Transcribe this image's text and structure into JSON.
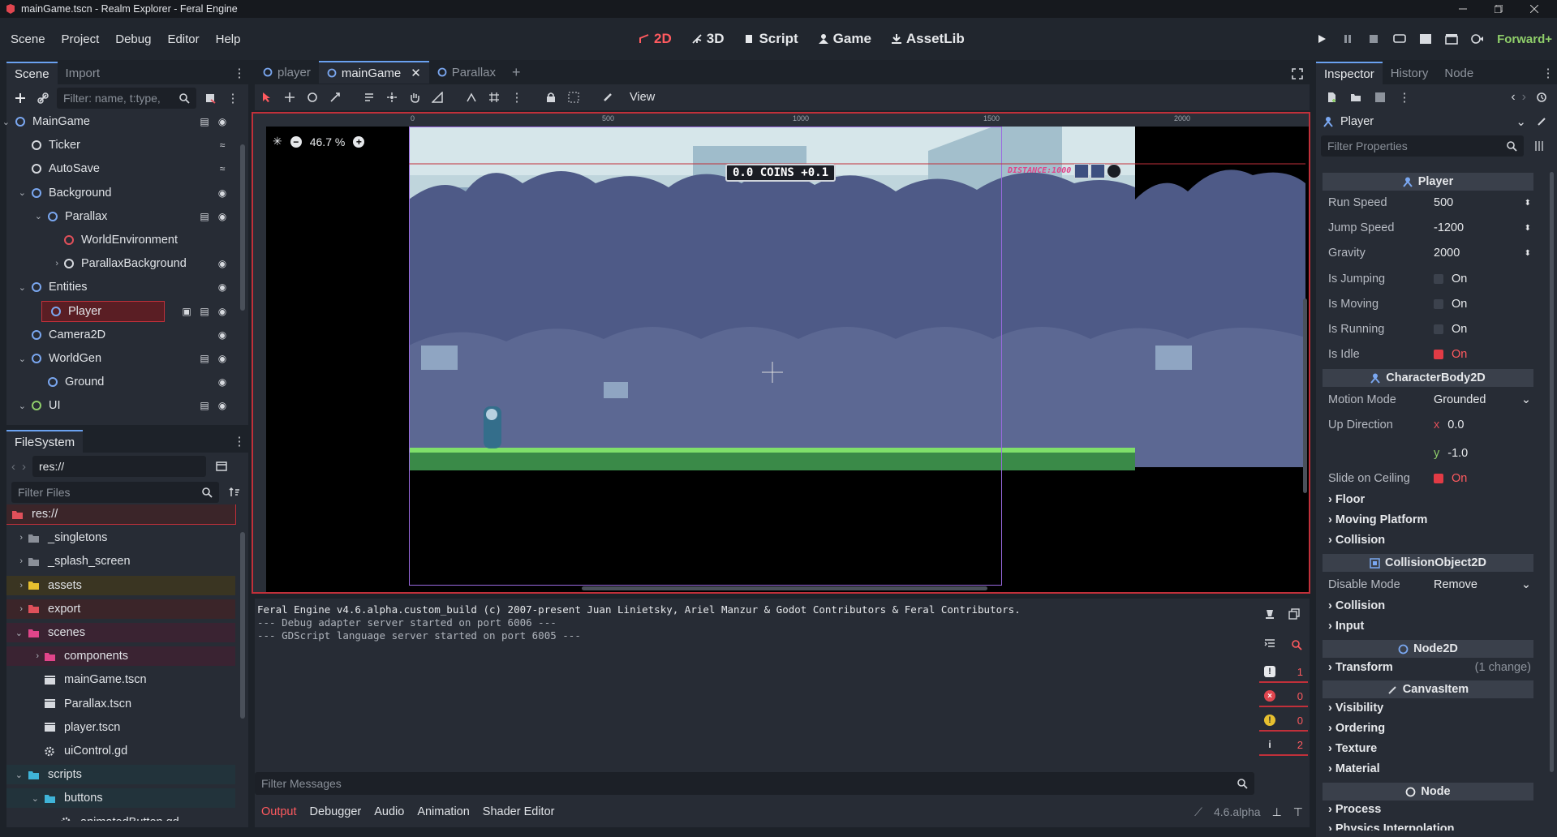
{
  "window": {
    "title": "mainGame.tscn - Realm Explorer - Feral Engine"
  },
  "menu": [
    "Scene",
    "Project",
    "Debug",
    "Editor",
    "Help"
  ],
  "workspaces": [
    {
      "label": "2D",
      "icon": "2d-icon",
      "active": true
    },
    {
      "label": "3D",
      "icon": "3d-icon",
      "active": false
    },
    {
      "label": "Script",
      "icon": "script-icon",
      "active": false
    },
    {
      "label": "Game",
      "icon": "game-icon",
      "active": false
    },
    {
      "label": "AssetLib",
      "icon": "assetlib-icon",
      "active": false
    }
  ],
  "renderer": "Forward+",
  "scene_dock": {
    "tabs": [
      "Scene",
      "Import"
    ],
    "filter_placeholder": "Filter: name, t:type,",
    "tree": [
      {
        "label": "MainGame",
        "depth": 0,
        "icon": "node2d-icon",
        "arrow": "down"
      },
      {
        "label": "Ticker",
        "depth": 1,
        "icon": "timer-icon"
      },
      {
        "label": "AutoSave",
        "depth": 1,
        "icon": "timer-icon"
      },
      {
        "label": "Background",
        "depth": 1,
        "icon": "node2d-icon",
        "arrow": "down"
      },
      {
        "label": "Parallax",
        "depth": 2,
        "icon": "node2d-icon",
        "arrow": "down"
      },
      {
        "label": "WorldEnvironment",
        "depth": 3,
        "icon": "world-environment-icon"
      },
      {
        "label": "ParallaxBackground",
        "depth": 3,
        "icon": "parallax-icon",
        "arrow": "right"
      },
      {
        "label": "Entities",
        "depth": 1,
        "icon": "node2d-icon",
        "arrow": "down"
      },
      {
        "label": "Player",
        "depth": 2,
        "icon": "character-icon",
        "selected": true
      },
      {
        "label": "Camera2D",
        "depth": 1,
        "icon": "camera-icon"
      },
      {
        "label": "WorldGen",
        "depth": 1,
        "icon": "node2d-icon",
        "arrow": "down"
      },
      {
        "label": "Ground",
        "depth": 2,
        "icon": "node2d-icon"
      },
      {
        "label": "UI",
        "depth": 1,
        "icon": "control-icon",
        "arrow": "down"
      }
    ]
  },
  "filesystem": {
    "title": "FileSystem",
    "path": "res://",
    "filter_placeholder": "Filter Files",
    "items": [
      {
        "label": "res://",
        "depth": 0,
        "type": "folder",
        "color": "#e0505a",
        "selected": true
      },
      {
        "label": "_singletons",
        "depth": 1,
        "type": "folder",
        "color": "#8a8f98"
      },
      {
        "label": "_splash_screen",
        "depth": 1,
        "type": "folder",
        "color": "#8a8f98"
      },
      {
        "label": "assets",
        "depth": 1,
        "type": "folder",
        "color": "#e7c02f"
      },
      {
        "label": "export",
        "depth": 1,
        "type": "folder",
        "color": "#e0505a"
      },
      {
        "label": "scenes",
        "depth": 1,
        "type": "folder",
        "color": "#e0458a",
        "open": true
      },
      {
        "label": "components",
        "depth": 2,
        "type": "folder",
        "color": "#e0458a"
      },
      {
        "label": "mainGame.tscn",
        "depth": 2,
        "type": "scene"
      },
      {
        "label": "Parallax.tscn",
        "depth": 2,
        "type": "scene"
      },
      {
        "label": "player.tscn",
        "depth": 2,
        "type": "scene"
      },
      {
        "label": "uiControl.gd",
        "depth": 2,
        "type": "script"
      },
      {
        "label": "scripts",
        "depth": 1,
        "type": "folder",
        "color": "#3fb4d8",
        "open": true
      },
      {
        "label": "buttons",
        "depth": 2,
        "type": "folder",
        "color": "#3fb4d8",
        "open": true
      },
      {
        "label": "animatedButton.gd",
        "depth": 3,
        "type": "script"
      }
    ]
  },
  "editor_tabs": [
    {
      "label": "player",
      "active": false,
      "icon": "character-icon"
    },
    {
      "label": "mainGame",
      "active": true,
      "icon": "node2d-icon"
    },
    {
      "label": "Parallax",
      "active": false,
      "icon": "node2d-icon"
    }
  ],
  "toolbar": {
    "view_label": "View"
  },
  "viewport": {
    "zoom": "46.7 %",
    "ruler_ticks": [
      "0",
      "500",
      "1000",
      "1500",
      "2000"
    ],
    "hud_coins": "0.0 COINS +0.1",
    "hud_distance": "DISTANCE:1000"
  },
  "output": {
    "lines": [
      "Feral Engine v4.6.alpha.custom_build (c) 2007-present Juan Linietsky, Ariel Manzur & Godot Contributors & Feral Contributors.",
      "--- Debug adapter server started on port 6006 ---",
      "--- GDScript language server started on port 6005 ---"
    ],
    "counts": {
      "messages": "1",
      "errors": "0",
      "warnings": "0",
      "info": "2"
    },
    "filter_placeholder": "Filter Messages",
    "bottom_tabs": [
      "Output",
      "Debugger",
      "Audio",
      "Animation",
      "Shader Editor"
    ],
    "version": "4.6.alpha"
  },
  "inspector": {
    "tabs": [
      "Inspector",
      "History",
      "Node"
    ],
    "object": "Player",
    "filter_placeholder": "Filter Properties",
    "sections": {
      "player": "Player",
      "characterbody": "CharacterBody2D",
      "collisionobject": "CollisionObject2D",
      "node2d": "Node2D",
      "canvasitem": "CanvasItem",
      "node": "Node"
    },
    "props": {
      "run_speed": {
        "label": "Run Speed",
        "value": "500"
      },
      "jump_speed": {
        "label": "Jump Speed",
        "value": "-1200"
      },
      "gravity": {
        "label": "Gravity",
        "value": "2000"
      },
      "is_jumping": {
        "label": "Is Jumping",
        "value": "On",
        "checked": false
      },
      "is_moving": {
        "label": "Is Moving",
        "value": "On",
        "checked": false
      },
      "is_running": {
        "label": "Is Running",
        "value": "On",
        "checked": false
      },
      "is_idle": {
        "label": "Is Idle",
        "value": "On",
        "checked": true
      },
      "motion_mode": {
        "label": "Motion Mode",
        "value": "Grounded"
      },
      "up_direction": {
        "label": "Up Direction",
        "x": "0.0",
        "y": "-1.0",
        "x_label": "x",
        "y_label": "y"
      },
      "slide_on_ceiling": {
        "label": "Slide on Ceiling",
        "value": "On",
        "checked": true
      },
      "disable_mode": {
        "label": "Disable Mode",
        "value": "Remove"
      }
    },
    "groups": {
      "floor": "Floor",
      "moving_platform": "Moving Platform",
      "collision1": "Collision",
      "collision2": "Collision",
      "input": "Input",
      "transform": "Transform",
      "transform_note": "(1 change)",
      "visibility": "Visibility",
      "ordering": "Ordering",
      "texture": "Texture",
      "material": "Material",
      "process": "Process",
      "physics_interp": "Physics Interpolation"
    }
  }
}
